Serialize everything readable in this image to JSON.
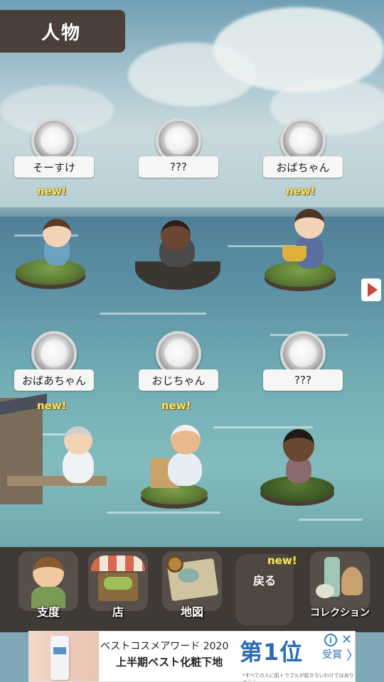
{
  "header": {
    "title": "人物"
  },
  "characters": [
    {
      "name": "そーすけ",
      "new": "new!"
    },
    {
      "name": "???",
      "new": ""
    },
    {
      "name": "おばちゃん",
      "new": "new!"
    },
    {
      "name": "おばあちゃん",
      "new": "new!"
    },
    {
      "name": "おじちゃん",
      "new": "new!"
    },
    {
      "name": "???",
      "new": ""
    }
  ],
  "nav": {
    "items": [
      {
        "label": "支度",
        "icon": "boy-icon"
      },
      {
        "label": "店",
        "icon": "shop-icon"
      },
      {
        "label": "地図",
        "icon": "map-icon"
      },
      {
        "label": "戻る",
        "icon": "back-icon"
      },
      {
        "label": "コレクション",
        "icon": "collection-icon"
      }
    ],
    "back_badge": "new!"
  },
  "ad": {
    "line1": "ベストコスメアワード 2020",
    "line2": "上半期ベスト化粧下地",
    "big": "第1位",
    "small": "受賞",
    "chevron": "〉",
    "note": "*すべての人に肌トラブルが起きないわけではありません。",
    "info": "i",
    "close": "✕"
  },
  "colors": {
    "header_bg": "#4a3f39",
    "new_badge": "#f7e26a",
    "arrow": "#c9473c",
    "ad_accent": "#2a6db4"
  }
}
